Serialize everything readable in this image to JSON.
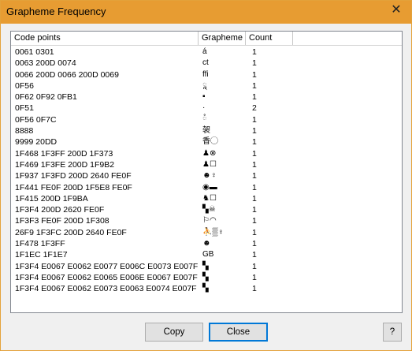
{
  "window": {
    "title": "Grapheme Frequency",
    "close_glyph": "✕"
  },
  "columns": [
    "Code points",
    "Grapheme",
    "Count"
  ],
  "rows": [
    {
      "code": "0061 0301",
      "grapheme": "á",
      "count": "1"
    },
    {
      "code": "0063 200D 0074",
      "grapheme": "ct",
      "count": "1"
    },
    {
      "code": "0066 200D 0066 200D 0069",
      "grapheme": "ffi",
      "count": "1"
    },
    {
      "code": "0F56",
      "grapheme": "ཱ",
      "count": "1"
    },
    {
      "code": "0F62 0F92 0FB1",
      "grapheme": "▪",
      "count": "1"
    },
    {
      "code": "0F51",
      "grapheme": "·",
      "count": "2"
    },
    {
      "code": "0F56 0F7C",
      "grapheme": "ཾ",
      "count": "1"
    },
    {
      "code": "8888",
      "grapheme": "袈",
      "count": "1"
    },
    {
      "code": "9999 20DD",
      "grapheme": "香◯",
      "count": "1"
    },
    {
      "code": "1F468 1F3FF 200D 1F373",
      "grapheme": "♟⊗",
      "count": "1"
    },
    {
      "code": "1F469 1F3FE 200D 1F9B2",
      "grapheme": "♟☐",
      "count": "1"
    },
    {
      "code": "1F937 1F3FD 200D 2640 FE0F",
      "grapheme": "☻♀",
      "count": "1"
    },
    {
      "code": "1F441 FE0F 200D 1F5E8 FE0F",
      "grapheme": "◉▬",
      "count": "1"
    },
    {
      "code": "1F415 200D 1F9BA",
      "grapheme": "♞☐",
      "count": "1"
    },
    {
      "code": "1F3F4 200D 2620 FE0F",
      "grapheme": "▚☠",
      "count": "1"
    },
    {
      "code": "1F3F3 FE0F 200D 1F308",
      "grapheme": "⚐◠",
      "count": "1"
    },
    {
      "code": "26F9 1F3FC 200D 2640 FE0F",
      "grapheme": "⛹▒♀",
      "count": "1"
    },
    {
      "code": "1F478 1F3FF",
      "grapheme": "☻",
      "count": "1"
    },
    {
      "code": "1F1EC 1F1E7",
      "grapheme": "GB",
      "count": "1"
    },
    {
      "code": "1F3F4 E0067 E0062 E0077 E006C E0073 E007F",
      "grapheme": "▚",
      "count": "1"
    },
    {
      "code": "1F3F4 E0067 E0062 E0065 E006E E0067 E007F",
      "grapheme": "▚",
      "count": "1"
    },
    {
      "code": "1F3F4 E0067 E0062 E0073 E0063 E0074 E007F",
      "grapheme": "▚",
      "count": "1"
    }
  ],
  "buttons": {
    "copy": "Copy",
    "close": "Close",
    "help": "?"
  }
}
